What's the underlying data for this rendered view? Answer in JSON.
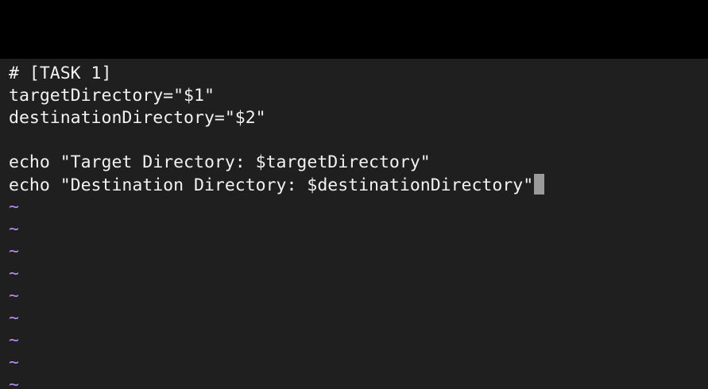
{
  "editor": {
    "lines": [
      "# [TASK 1]",
      "targetDirectory=\"$1\"",
      "destinationDirectory=\"$2\"",
      "",
      "echo \"Target Directory: $targetDirectory\"",
      "echo \"Destination Directory: $destinationDirectory\""
    ],
    "empty_line_marker": "~",
    "colors": {
      "background": "#1f1f1f",
      "text": "#f2f2f2",
      "tilde": "#b58ee8",
      "cursor": "#9a9a9a",
      "top_bar": "#000000"
    }
  }
}
